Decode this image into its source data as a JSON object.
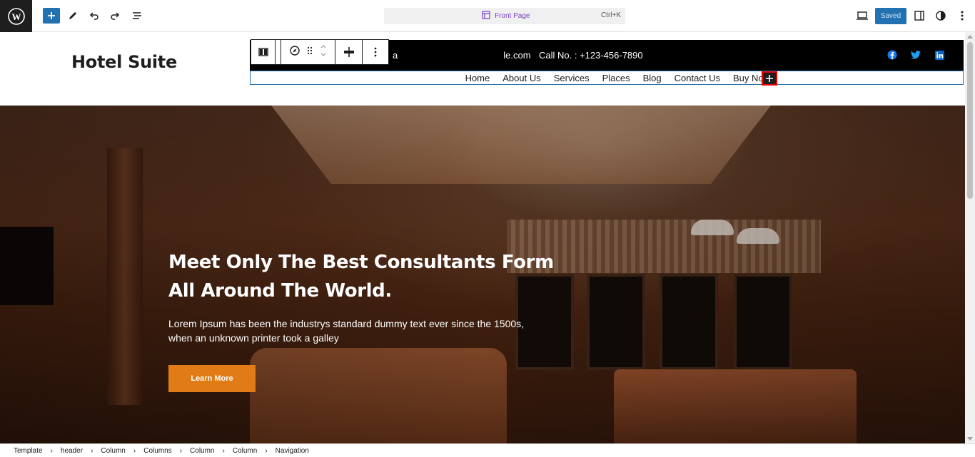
{
  "editor": {
    "document_title": "Front Page",
    "shortcut": "Ctrl+K",
    "saved_label": "Saved"
  },
  "site": {
    "title": "Hotel Suite",
    "email_partial": "le.com",
    "email_prefix": "a",
    "call": "Call No. : +123-456-7890",
    "nav": [
      "Home",
      "About Us",
      "Services",
      "Places",
      "Blog",
      "Contact Us",
      "Buy Now"
    ],
    "nav_plus": "+"
  },
  "hero": {
    "heading_line1": "Meet Only The Best Consultants Form",
    "heading_line2": "All Around The World.",
    "text": "Lorem Ipsum has been the industrys standard dummy text ever since the 1500s, when an unknown printer took a galley",
    "button": "Learn More"
  },
  "breadcrumb": [
    "Template",
    "header",
    "Column",
    "Columns",
    "Column",
    "Column",
    "Navigation"
  ],
  "colors": {
    "accent": "#2271b1",
    "button_orange": "#e07b16",
    "highlight_red": "#ee0000"
  }
}
